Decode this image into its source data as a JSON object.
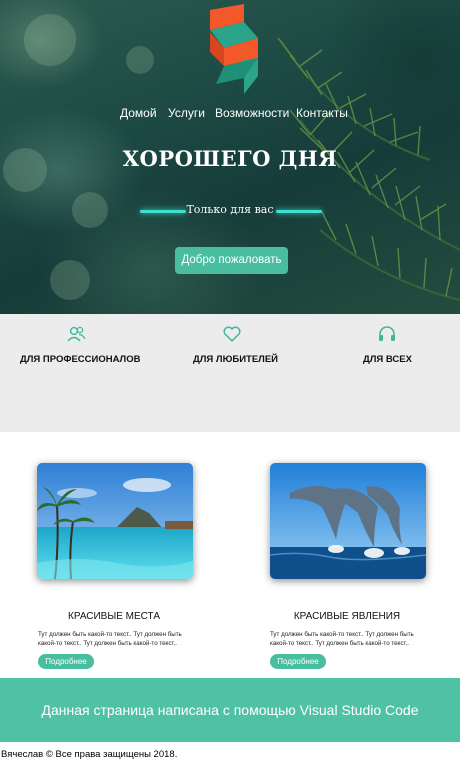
{
  "hero": {
    "nav": [
      {
        "label": "Домой"
      },
      {
        "label": "Услуги"
      },
      {
        "label": "Возможности"
      },
      {
        "label": "Контакты"
      }
    ],
    "title": "ХОРОШЕГО ДНЯ",
    "tagline": "Только для вас",
    "cta_label": "Добро пожаловать"
  },
  "features": [
    {
      "label": "ДЛЯ ПРОФЕССИОНАЛОВ",
      "icon": "users-icon"
    },
    {
      "label": "ДЛЯ ЛЮБИТЕЛЕЙ",
      "icon": "heart-icon"
    },
    {
      "label": "ДЛЯ ВСЕХ",
      "icon": "headphones-icon"
    }
  ],
  "cards": [
    {
      "title": "КРАСИВЫЕ МЕСТА",
      "text": "Тут должен быть какой-то текст.. Тут должен быть какой-то текст.. Тут должен быть какой-то текст..",
      "button": "Подробнее",
      "image": "tropical-lagoon-image"
    },
    {
      "title": "КРАСИВЫЕ ЯВЛЕНИЯ",
      "text": "Тут должен быть какой-то текст.. Тут должен быть какой-то текст.. Тут должен быть какой-то текст..",
      "button": "Подробнее",
      "image": "jumping-dolphins-image"
    }
  ],
  "footer": {
    "banner": "Данная страница написана с помощью Visual Studio Code",
    "copyright": "Вячеслав © Все права защищены 2018."
  },
  "colors": {
    "accent": "#49bda0",
    "banner": "#4fc1a5",
    "glow_line": "#3fe0d0",
    "logo_orange": "#f2582a",
    "logo_teal": "#2aa58a"
  }
}
